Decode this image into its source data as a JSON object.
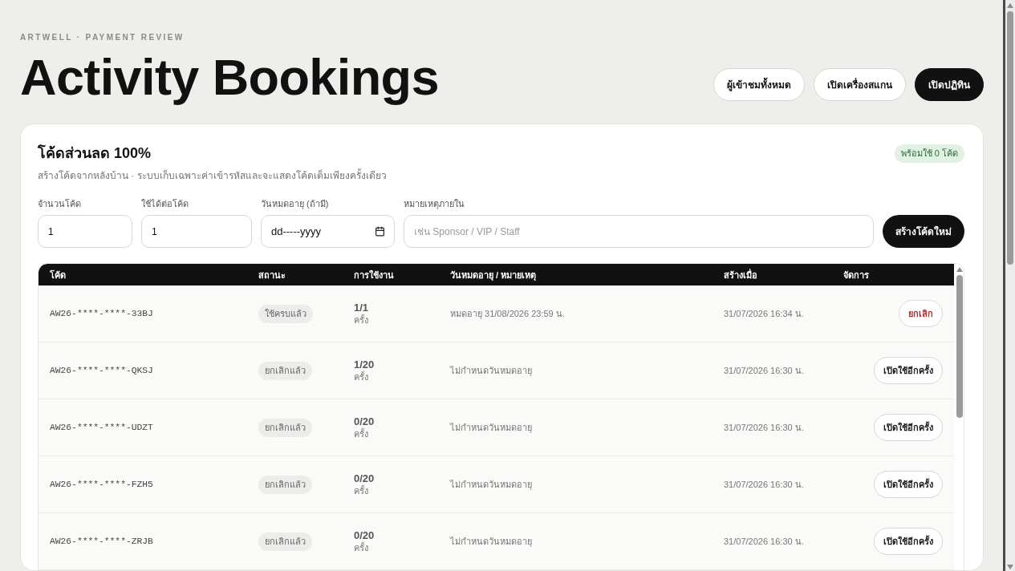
{
  "header": {
    "eyebrow": "ARTWELL · PAYMENT REVIEW",
    "title": "Activity Bookings",
    "actions": [
      {
        "label": "ผู้เข้าชมทั้งหมด",
        "kind": "secondary"
      },
      {
        "label": "เปิดเครื่องสแกน",
        "kind": "secondary"
      },
      {
        "label": "เปิดปฏิทิน",
        "kind": "primary"
      }
    ]
  },
  "codes_panel": {
    "title": "โค้ดส่วนลด 100%",
    "badge": "พร้อมใช้ 0 โค้ด",
    "subtitle": "สร้างโค้ดจากหลังบ้าน · ระบบเก็บเฉพาะค่าเข้ารหัสและจะแสดงโค้ดเต็มเพียงครั้งเดียว",
    "form": {
      "fields": [
        {
          "label": "จำนวนโค้ด",
          "kind": "number",
          "value": "1"
        },
        {
          "label": "ใช้ได้ต่อโค้ด",
          "kind": "number",
          "value": "1"
        },
        {
          "label": "วันหมดอายุ (ถ้ามี)",
          "kind": "date",
          "placeholder": "dd-----yyyy"
        },
        {
          "label": "หมายเหตุภายใน",
          "kind": "text",
          "placeholder": "เช่น Sponsor / VIP / Staff"
        }
      ],
      "submit": "สร้างโค้ดใหม่"
    },
    "table": {
      "columns": [
        "โค้ด",
        "สถานะ",
        "การใช้งาน",
        "วันหมดอายุ / หมายเหตุ",
        "สร้างเมื่อ",
        "จัดการ"
      ],
      "rows": [
        {
          "code": "AW26-****-****-33BJ",
          "status": "ใช้ครบแล้ว",
          "usage": {
            "count": "1/1",
            "unit": "ครั้ง"
          },
          "expiry": "หมดอายุ 31/08/2026 23:59 น.",
          "created": "31/07/2026 16:34 น.",
          "action": {
            "label": "ยกเลิก",
            "kind": "cancel"
          }
        },
        {
          "code": "AW26-****-****-QKSJ",
          "status": "ยกเลิกแล้ว",
          "usage": {
            "count": "1/20",
            "unit": "ครั้ง"
          },
          "expiry": "ไม่กำหนดวันหมดอายุ",
          "created": "31/07/2026 16:30 น.",
          "action": {
            "label": "เปิดใช้อีกครั้ง",
            "kind": "reactivate"
          }
        },
        {
          "code": "AW26-****-****-UDZT",
          "status": "ยกเลิกแล้ว",
          "usage": {
            "count": "0/20",
            "unit": "ครั้ง"
          },
          "expiry": "ไม่กำหนดวันหมดอายุ",
          "created": "31/07/2026 16:30 น.",
          "action": {
            "label": "เปิดใช้อีกครั้ง",
            "kind": "reactivate"
          }
        },
        {
          "code": "AW26-****-****-FZH5",
          "status": "ยกเลิกแล้ว",
          "usage": {
            "count": "0/20",
            "unit": "ครั้ง"
          },
          "expiry": "ไม่กำหนดวันหมดอายุ",
          "created": "31/07/2026 16:30 น.",
          "action": {
            "label": "เปิดใช้อีกครั้ง",
            "kind": "reactivate"
          }
        },
        {
          "code": "AW26-****-****-ZRJB",
          "status": "ยกเลิกแล้ว",
          "usage": {
            "count": "0/20",
            "unit": "ครั้ง"
          },
          "expiry": "ไม่กำหนดวันหมดอายุ",
          "created": "31/07/2026 16:30 น.",
          "action": {
            "label": "เปิดใช้อีกครั้ง",
            "kind": "reactivate"
          }
        }
      ]
    }
  }
}
